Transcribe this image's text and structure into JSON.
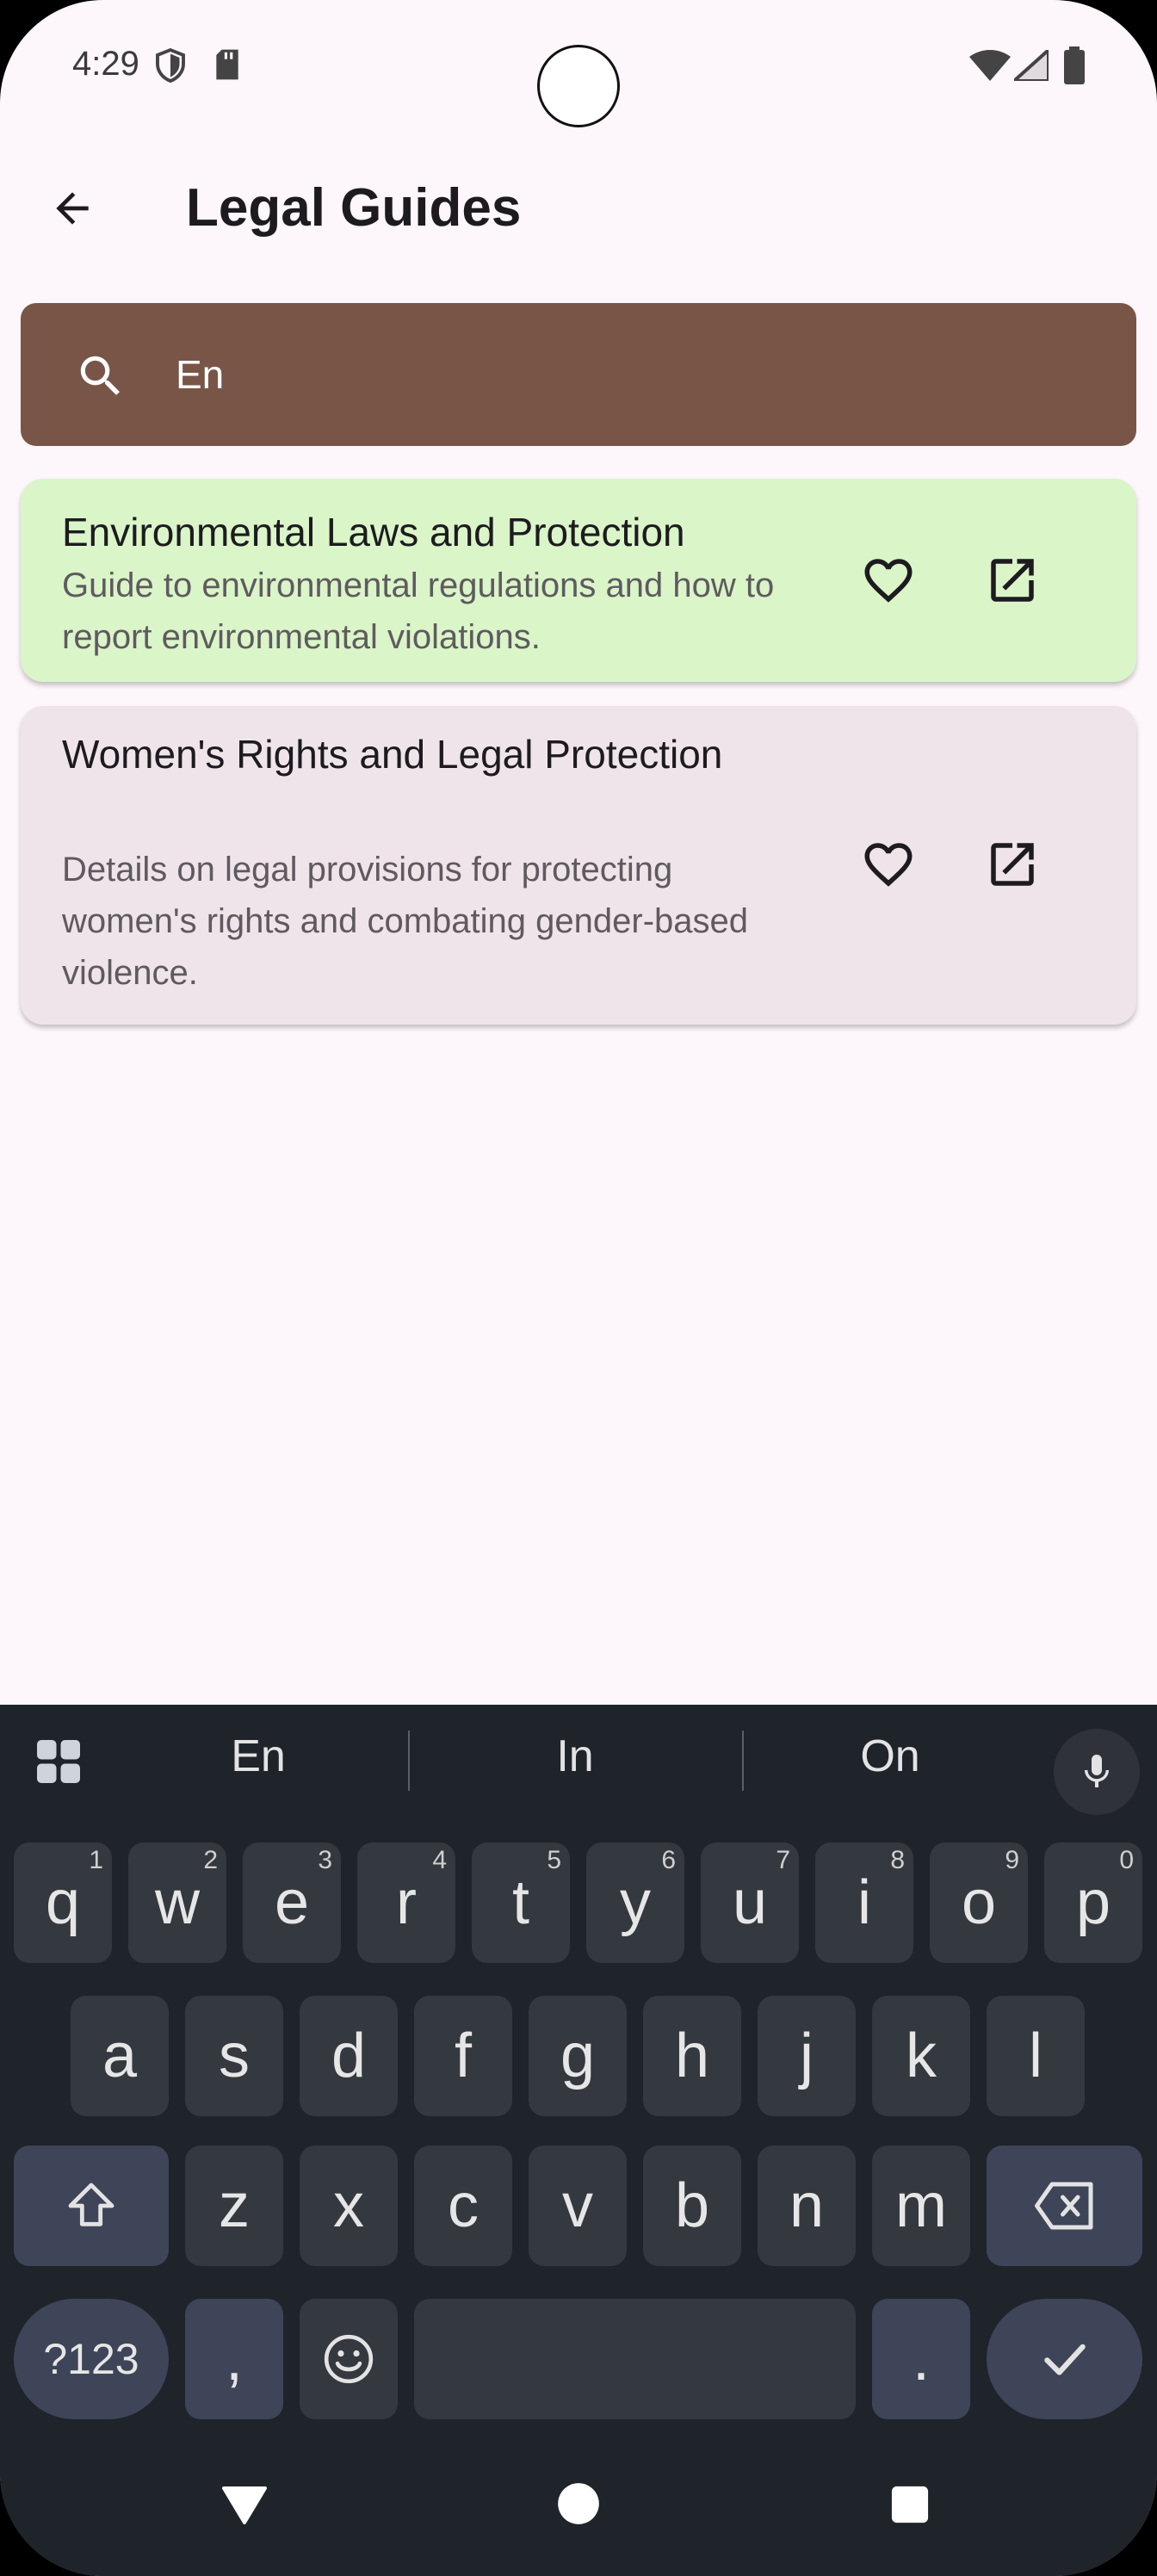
{
  "status_bar": {
    "time": "4:29"
  },
  "app_bar": {
    "title": "Legal Guides"
  },
  "search": {
    "value": "En"
  },
  "guides": [
    {
      "title": "Environmental Laws and Protection",
      "description": "Guide to environmental regulations and how to report environmental violations."
    },
    {
      "title": "Women's Rights and Legal Protection",
      "description": "Details on legal provisions for protecting women's rights and combating gender-based violence."
    }
  ],
  "keyboard": {
    "suggestions": [
      "En",
      "In",
      "On"
    ],
    "row1": [
      {
        "key": "q",
        "hint": "1"
      },
      {
        "key": "w",
        "hint": "2"
      },
      {
        "key": "e",
        "hint": "3"
      },
      {
        "key": "r",
        "hint": "4"
      },
      {
        "key": "t",
        "hint": "5"
      },
      {
        "key": "y",
        "hint": "6"
      },
      {
        "key": "u",
        "hint": "7"
      },
      {
        "key": "i",
        "hint": "8"
      },
      {
        "key": "o",
        "hint": "9"
      },
      {
        "key": "p",
        "hint": "0"
      }
    ],
    "row2": [
      "a",
      "s",
      "d",
      "f",
      "g",
      "h",
      "j",
      "k",
      "l"
    ],
    "row3": [
      "z",
      "x",
      "c",
      "v",
      "b",
      "n",
      "m"
    ],
    "symbols_label": "?123",
    "comma": ",",
    "period": "."
  },
  "colors": {
    "background": "#FDF6FB",
    "search_bar": "#795548",
    "card_highlight": "#DAF5C8",
    "card_default": "#EFE4EA",
    "keyboard": "#1F232A"
  }
}
